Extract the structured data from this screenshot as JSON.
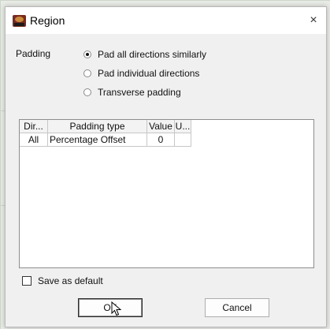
{
  "window": {
    "title": "Region",
    "close_glyph": "×"
  },
  "padding": {
    "label": "Padding",
    "options": [
      {
        "label": "Pad all directions similarly",
        "selected": true
      },
      {
        "label": "Pad individual directions",
        "selected": false
      },
      {
        "label": "Transverse padding",
        "selected": false
      }
    ]
  },
  "table": {
    "columns": [
      "Dir...",
      "Padding type",
      "Value",
      "U..."
    ],
    "rows": [
      {
        "dir": "All",
        "padding_type": "Percentage Offset",
        "value": "0",
        "unit": ""
      }
    ]
  },
  "save_default": {
    "label": "Save as default",
    "checked": false
  },
  "buttons": {
    "ok": "OK",
    "cancel": "Cancel"
  },
  "icons": {
    "app": "region-app-icon",
    "cursor": "mouse-pointer-icon"
  }
}
